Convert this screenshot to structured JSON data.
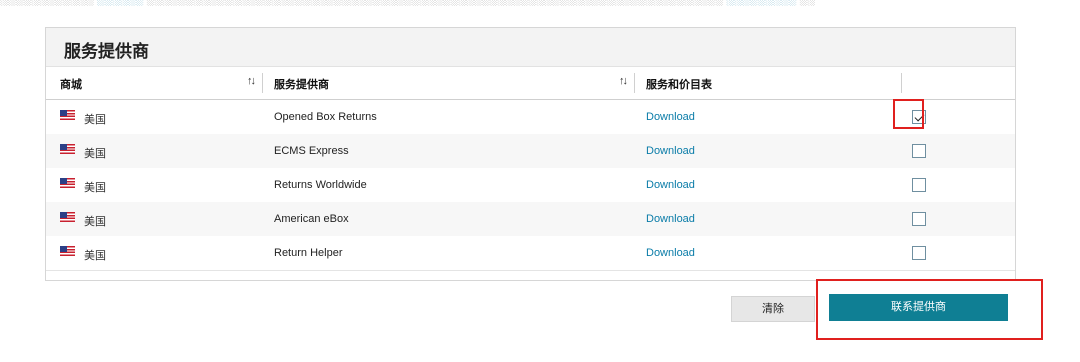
{
  "colors": {
    "accent": "#0f7f94",
    "link": "#0a7ca8",
    "highlight": "#e0201e",
    "header_bg": "#f3f3f3"
  },
  "panel": {
    "title": "服务提供商"
  },
  "table": {
    "headers": {
      "market": "商城",
      "provider": "服务提供商",
      "price_list": "服务和价目表"
    },
    "sort_icon": "sort-arrows-icon",
    "rows": [
      {
        "country": "美国",
        "flag": "us-flag-icon",
        "provider": "Opened Box Returns",
        "link": "Download",
        "checked": true
      },
      {
        "country": "美国",
        "flag": "us-flag-icon",
        "provider": "ECMS Express",
        "link": "Download",
        "checked": false
      },
      {
        "country": "美国",
        "flag": "us-flag-icon",
        "provider": "Returns Worldwide",
        "link": "Download",
        "checked": false
      },
      {
        "country": "美国",
        "flag": "us-flag-icon",
        "provider": "American eBox",
        "link": "Download",
        "checked": false
      },
      {
        "country": "美国",
        "flag": "us-flag-icon",
        "provider": "Return Helper",
        "link": "Download",
        "checked": false
      }
    ]
  },
  "actions": {
    "clear_label": "清除",
    "contact_label": "联系提供商"
  }
}
